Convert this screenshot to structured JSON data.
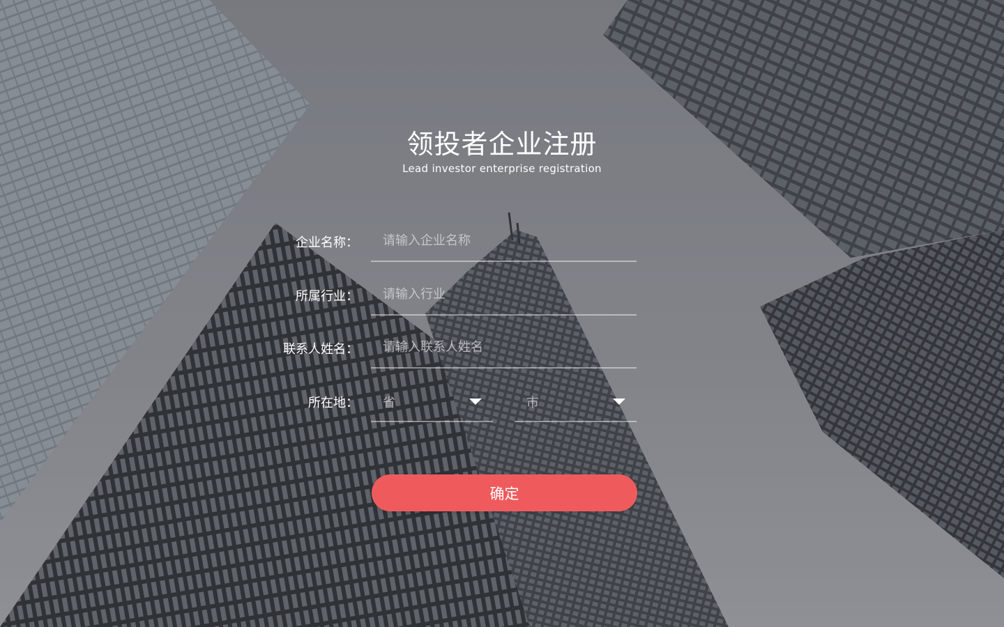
{
  "header": {
    "title": "领投者企业注册",
    "subtitle": "Lead investor enterprise registration"
  },
  "form": {
    "company_name": {
      "label": "企业名称：",
      "value": "",
      "placeholder": "请输入企业名称"
    },
    "industry": {
      "label": "所属行业：",
      "value": "",
      "placeholder": "请输入行业"
    },
    "contact_name": {
      "label": "联系人姓名：",
      "value": "",
      "placeholder": "请输入联系人姓名"
    },
    "location": {
      "label": "所在地：",
      "province": {
        "value": "省",
        "icon": "chevron-down-icon"
      },
      "city": {
        "value": "市",
        "icon": "chevron-down-icon"
      }
    },
    "submit_label": "确定"
  },
  "colors": {
    "accent": "#ef5b5d",
    "background": "#8a8b91",
    "text": "#ffffff",
    "placeholder": "#c8c8ce",
    "underline": "#b6b7bb"
  },
  "background_image": "skyscrapers-looking-up"
}
